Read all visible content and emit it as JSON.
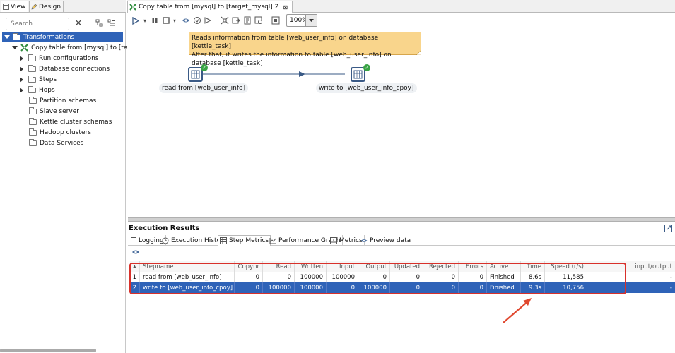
{
  "left_panel": {
    "tabs": [
      {
        "label": "View",
        "icon": "view-icon"
      },
      {
        "label": "Design",
        "icon": "pencil-icon"
      }
    ],
    "search_placeholder": "Search",
    "tree": [
      {
        "label": "Transformations",
        "selected": true
      },
      {
        "label": "Copy table from [mysql] to [target_"
      },
      {
        "label": "Run configurations"
      },
      {
        "label": "Database connections"
      },
      {
        "label": "Steps"
      },
      {
        "label": "Hops"
      },
      {
        "label": "Partition schemas"
      },
      {
        "label": "Slave server"
      },
      {
        "label": "Kettle cluster schemas"
      },
      {
        "label": "Hadoop clusters"
      },
      {
        "label": "Data Services"
      }
    ]
  },
  "editor": {
    "tab_label": "Copy table from [mysql] to [target_mysql] 2",
    "zoom": "100%"
  },
  "canvas": {
    "note_lines": [
      "Reads information from table [web_user_info] on database [kettle_task]",
      "After that, it writes the information to table [web_user_info] on database [kettle_task]"
    ],
    "steps": [
      {
        "label": "read from [web_user_info]"
      },
      {
        "label": "write to [web_user_info_cpoy]"
      }
    ]
  },
  "execution": {
    "title": "Execution Results",
    "tabs": [
      "Logging",
      "Execution History",
      "Step Metrics",
      "Performance Graph",
      "Metrics",
      "Preview data"
    ],
    "columns": [
      "",
      "Stepname",
      "Copynr",
      "Read",
      "Written",
      "Input",
      "Output",
      "Updated",
      "Rejected",
      "Errors",
      "Active",
      "Time",
      "Speed (r/s)",
      "input/output"
    ],
    "rows": [
      [
        "1",
        "read from [web_user_info]",
        "0",
        "0",
        "100000",
        "100000",
        "0",
        "0",
        "0",
        "0",
        "Finished",
        "8.6s",
        "11,585",
        "-"
      ],
      [
        "2",
        "write to [web_user_info_cpoy]",
        "0",
        "100000",
        "100000",
        "0",
        "100000",
        "0",
        "0",
        "0",
        "Finished",
        "9.3s",
        "10,756",
        "-"
      ]
    ]
  },
  "colors": {
    "selection": "#2f63b8",
    "note": "#f9d58c",
    "highlight": "#d8312b",
    "ok": "#3aa445"
  }
}
